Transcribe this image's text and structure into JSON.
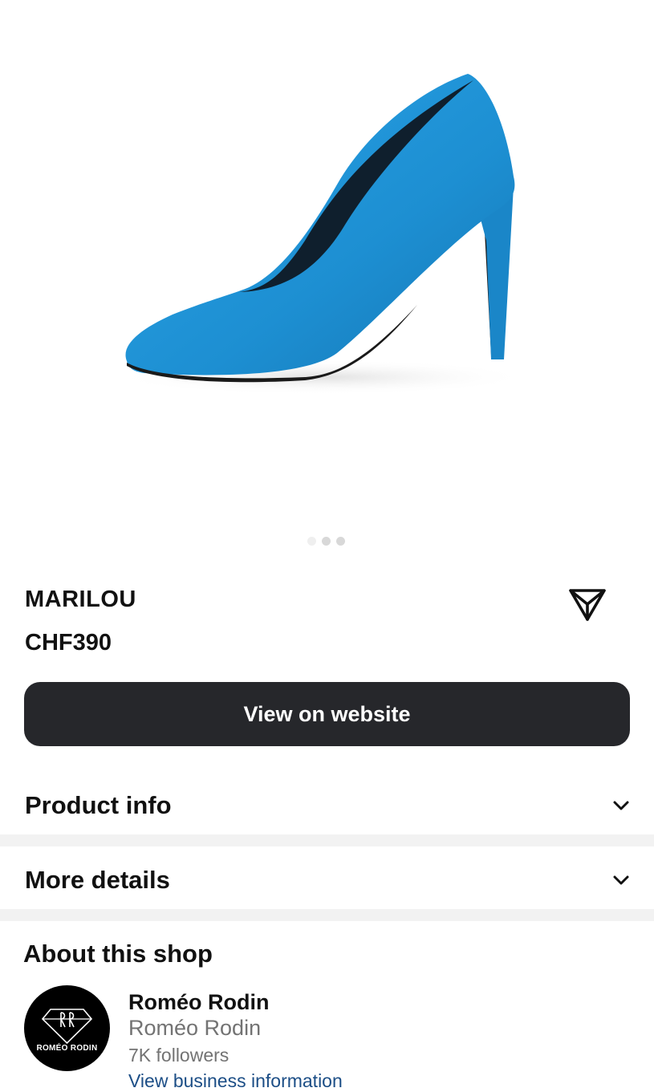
{
  "product": {
    "image_name": "blue-suede-pump",
    "colors": {
      "shoe": "#1d8fd2",
      "sole": "#1a1a1a"
    },
    "carousel": {
      "total": 3,
      "active_index": 0
    },
    "title": "MARILOU",
    "price": "CHF390",
    "cta_label": "View on website"
  },
  "sections": {
    "product_info": "Product info",
    "more_details": "More details"
  },
  "shop": {
    "section_title": "About this shop",
    "avatar_text": "ROMÉO RODIN",
    "name": "Roméo Rodin",
    "handle": "Roméo Rodin",
    "followers": "7K followers",
    "link_label": "View business information"
  },
  "icons": {
    "share": "paper-plane-icon",
    "expand": "chevron-down-icon"
  },
  "colors": {
    "cta_background": "#26272b",
    "separator": "#f2f2f2",
    "link": "#1c4e86",
    "muted_text": "#737373"
  }
}
